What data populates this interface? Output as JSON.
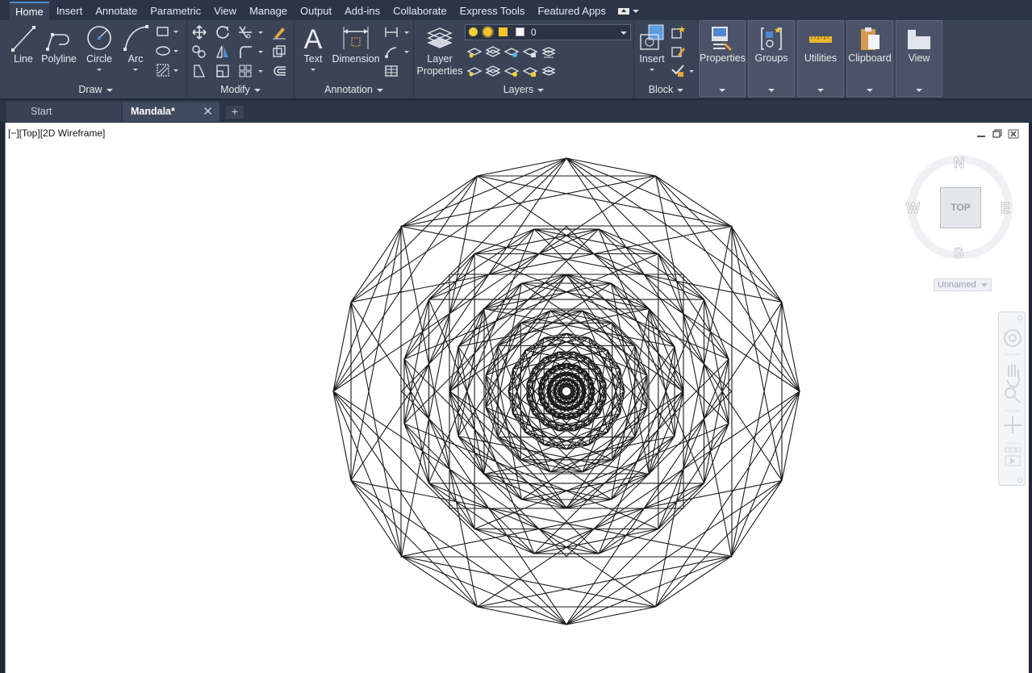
{
  "ribbon_tabs": [
    "Home",
    "Insert",
    "Annotate",
    "Parametric",
    "View",
    "Manage",
    "Output",
    "Add-ins",
    "Collaborate",
    "Express Tools",
    "Featured Apps"
  ],
  "active_tab": "Home",
  "panels": {
    "draw": {
      "title": "Draw",
      "buttons": [
        "Line",
        "Polyline",
        "Circle",
        "Arc"
      ]
    },
    "modify": {
      "title": "Modify"
    },
    "annotation": {
      "title": "Annotation",
      "buttons": [
        "Text",
        "Dimension"
      ]
    },
    "layers": {
      "title": "Layers",
      "button": "Layer\nProperties",
      "current_layer": "0"
    },
    "block": {
      "title": "Block",
      "button": "Insert"
    },
    "tiles": [
      "Properties",
      "Groups",
      "Utilities",
      "Clipboard",
      "View"
    ]
  },
  "file_tabs": {
    "start": "Start",
    "active": "Mandala*",
    "add_symbol": "+",
    "close_symbol": "✕"
  },
  "viewport": {
    "label": "[−][Top][2D Wireframe]",
    "viewcube": {
      "north": "N",
      "south": "S",
      "east": "E",
      "west": "W",
      "face": "TOP"
    },
    "wcs_label": "Unnamed"
  },
  "colors": {
    "ribbon_bg": "#3b4456",
    "tabbar_bg": "#2b3547",
    "canvas_bg": "#ffffff",
    "line": "#1a1a1a",
    "accent": "#4e8ad0"
  }
}
